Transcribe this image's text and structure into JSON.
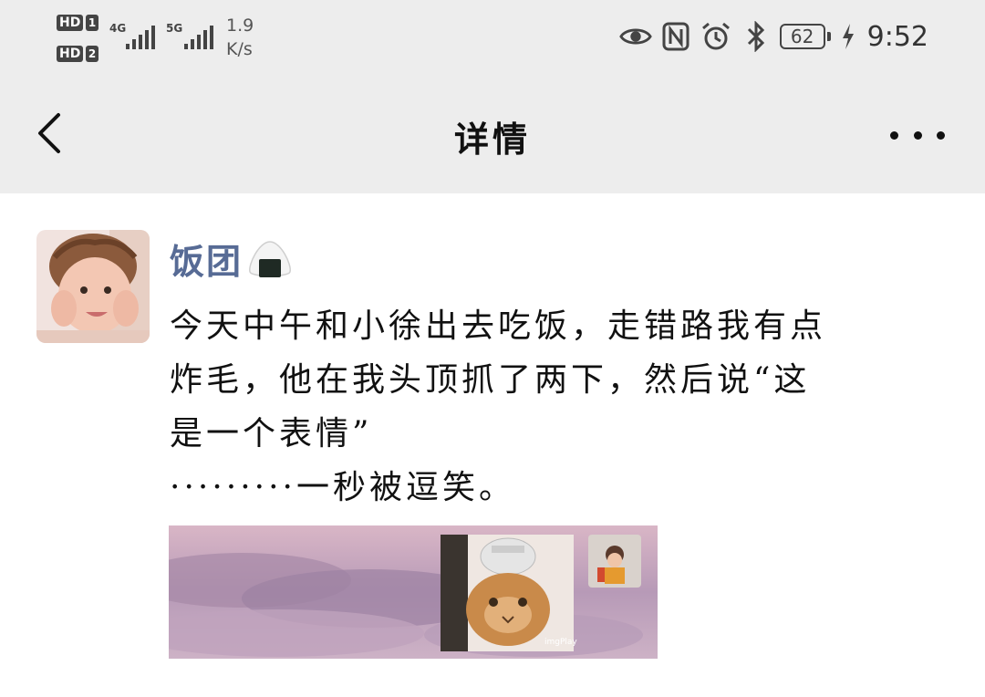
{
  "status_bar": {
    "sim1_label": "HD",
    "sim1_num": "1",
    "sim2_label": "HD",
    "sim2_num": "2",
    "net1_type": "4G",
    "net2_type": "5G",
    "speed_value": "1.9",
    "speed_unit": "K/s",
    "battery_level": "62",
    "time": "9:52",
    "icons": [
      "eye-icon",
      "nfc-icon",
      "alarm-icon",
      "bluetooth-icon",
      "battery-icon",
      "charging-icon"
    ]
  },
  "nav": {
    "title": "详情",
    "back_icon": "chevron-left-icon",
    "more_icon": "more-dots-icon"
  },
  "post": {
    "author": "饭团",
    "author_emoji": "rice-ball-icon",
    "text": "今天中午和小徐出去吃饭，走错路我有点\n炸毛，他在我头顶抓了两下，然后说“这\n是一个表情”\n·········一秒被逗笑。",
    "image_watermark": "imgPlay"
  },
  "colors": {
    "nav_background": "#ededed",
    "author_name": "#576b95",
    "body_text": "#111111"
  }
}
